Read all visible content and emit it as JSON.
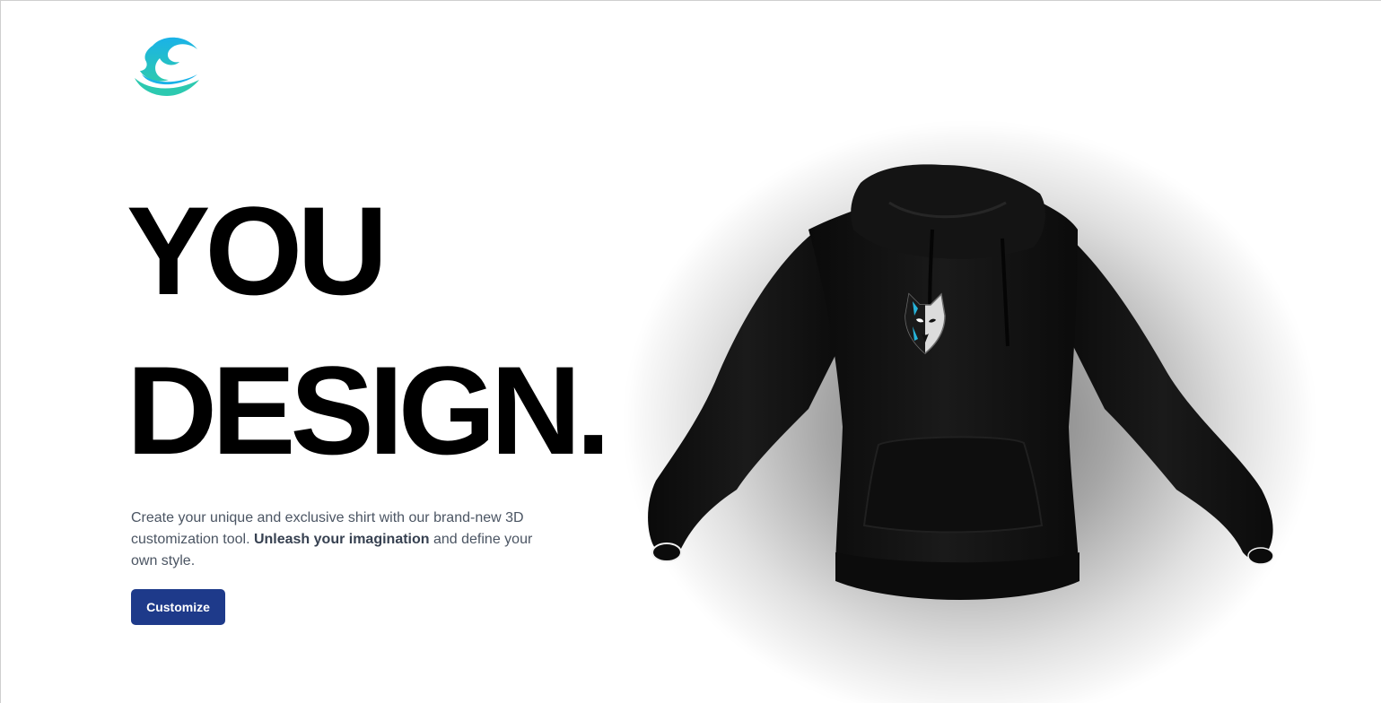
{
  "brand": {
    "logo_icon": "wave-logo-icon",
    "colors": {
      "logo_top": "#1ab2e8",
      "logo_bottom": "#2cc9b0"
    }
  },
  "hero": {
    "headline_line1": "YOU",
    "headline_line2": "DESIGN.",
    "description_lead": "Create your unique and exclusive shirt with our brand-new 3D customization tool. ",
    "description_bold": "Unleash your imagination",
    "description_tail": " and define your own style.",
    "cta_label": "Customize",
    "cta_color": "#1e3a8a"
  },
  "preview": {
    "garment": "hoodie",
    "garment_color": "#111111",
    "emblem_icon": "wolf-emblem-icon"
  }
}
